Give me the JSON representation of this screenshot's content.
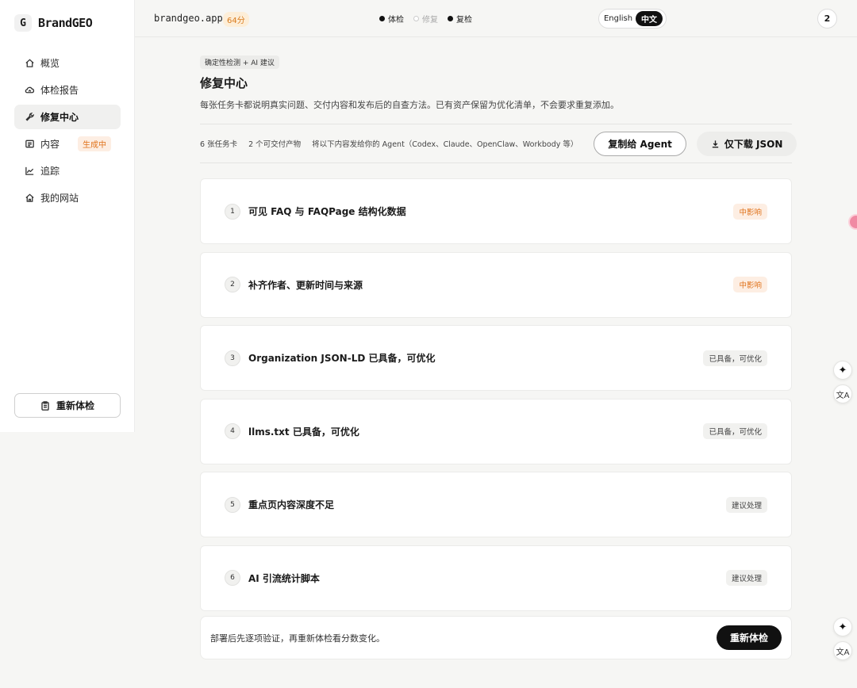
{
  "sidebar": {
    "logo_letter": "G",
    "brand": "BrandGEO",
    "items": [
      {
        "label": "概览",
        "icon": "home-icon"
      },
      {
        "label": "体检报告",
        "icon": "cloud-icon"
      },
      {
        "label": "修复中心",
        "icon": "wrench-icon",
        "active": true
      },
      {
        "label": "内容",
        "icon": "document-icon",
        "badge": "生成中"
      },
      {
        "label": "追踪",
        "icon": "chart-line-icon"
      },
      {
        "label": "我的网站",
        "icon": "house-icon"
      }
    ],
    "recheck_label": "重新体检"
  },
  "topbar": {
    "domain": "brandgeo.app",
    "score": "64分",
    "steps": [
      {
        "label": "体检",
        "state": "done"
      },
      {
        "label": "修复",
        "state": "current"
      },
      {
        "label": "复检",
        "state": "done"
      }
    ],
    "lang": {
      "en": "English",
      "zh": "中文",
      "selected": "中文"
    },
    "avatar": "2"
  },
  "main": {
    "eyebrow": "确定性检测 + AI 建议",
    "title": "修复中心",
    "subtitle": "每张任务卡都说明真实问题、交付内容和发布后的自查方法。已有资产保留为优化清单，不会要求重复添加。",
    "toolbar": {
      "task_count": "6 张任务卡",
      "deliverable_count": "2 个可交付产物",
      "hint": "将以下内容发给你的 Agent（Codex、Claude、OpenClaw、Workbody 等）",
      "copy_label": "复制给 Agent",
      "download_label": "仅下载 JSON"
    },
    "cards": [
      {
        "num": "1",
        "title": "可见 FAQ 与 FAQPage 结构化数据",
        "tag": "中影响",
        "tag_style": "orange"
      },
      {
        "num": "2",
        "title": "补齐作者、更新时间与来源",
        "tag": "中影响",
        "tag_style": "orange"
      },
      {
        "num": "3",
        "title": "Organization JSON-LD 已具备，可优化",
        "tag": "已具备，可优化",
        "tag_style": "gray"
      },
      {
        "num": "4",
        "title": "llms.txt 已具备，可优化",
        "tag": "已具备，可优化",
        "tag_style": "gray"
      },
      {
        "num": "5",
        "title": "重点页内容深度不足",
        "tag": "建议处理",
        "tag_style": "gray"
      },
      {
        "num": "6",
        "title": "AI 引流统计脚本",
        "tag": "建议处理",
        "tag_style": "gray"
      }
    ],
    "footer": {
      "text": "部署后先逐项验证，再重新体检看分数变化。",
      "recheck_label": "重新体检"
    }
  },
  "floating": {
    "sparkle_glyph": "✦",
    "translate_glyph": "文A"
  },
  "colors": {
    "accent_orange": "#e0731c",
    "orange_bg": "#fdeee3",
    "dark": "#111111",
    "page_bg": "#f6f6f4"
  }
}
